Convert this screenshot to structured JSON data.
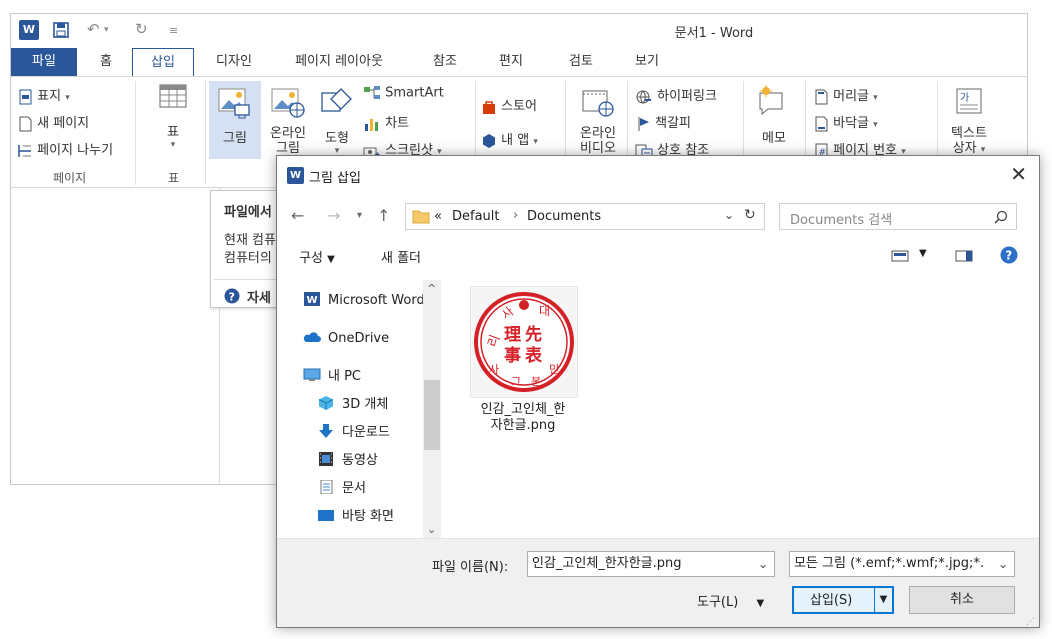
{
  "word": {
    "title": "문서1 - Word",
    "tabs": [
      {
        "label": "파일"
      },
      {
        "label": "홈"
      },
      {
        "label": "삽입"
      },
      {
        "label": "디자인"
      },
      {
        "label": "페이지 레이아웃"
      },
      {
        "label": "참조"
      },
      {
        "label": "편지"
      },
      {
        "label": "검토"
      },
      {
        "label": "보기"
      }
    ],
    "ribbon": {
      "pages_group": {
        "cover": "표지",
        "new_page": "새 페이지",
        "page_break": "페이지 나누기",
        "label": "페이지"
      },
      "table_group": {
        "table": "표",
        "label": "표"
      },
      "illustrations": {
        "picture": "그림",
        "online_picture_1": "온라인",
        "online_picture_2": "그림",
        "shapes": "도형",
        "smartart": "SmartArt",
        "chart": "차트",
        "screenshot": "스크린샷"
      },
      "addins": {
        "store": "스토어",
        "my_apps": "내 앱"
      },
      "media": {
        "online_video_1": "온라인",
        "online_video_2": "비디오"
      },
      "links": {
        "hyperlink": "하이퍼링크",
        "bookmark": "책갈피",
        "cross_ref": "상호 참조"
      },
      "comments": {
        "memo": "메모"
      },
      "header_footer": {
        "header": "머리글",
        "footer": "바닥글",
        "page_number": "페이지 번호"
      },
      "text": {
        "textbox_1": "텍스트",
        "textbox_2": "상자"
      }
    },
    "tooltip": {
      "line1": "파일에서",
      "line2": "현재 컴퓨",
      "line3": "컴퓨터의",
      "more": "자세"
    }
  },
  "dialog": {
    "title": "그림 삽입",
    "path": {
      "prefix": "«",
      "segments": [
        "Default",
        "Documents"
      ]
    },
    "search_placeholder": "Documents 검색",
    "toolbar": {
      "organize": "구성",
      "new_folder": "새 폴더"
    },
    "nav": [
      {
        "label": "Microsoft Word"
      },
      {
        "label": "OneDrive"
      },
      {
        "label": "내 PC"
      },
      {
        "label": "3D 개체"
      },
      {
        "label": "다운로드"
      },
      {
        "label": "동영상"
      },
      {
        "label": "문서"
      },
      {
        "label": "바탕 화면"
      }
    ],
    "file": {
      "name_line1": "인감_고인체_한",
      "name_line2": "자한글.png"
    },
    "seal": {
      "top": "대",
      "left": "리",
      "right": "사",
      "c1": "理",
      "c2": "先",
      "c3": "事",
      "c4": "表",
      "b1": "사",
      "b2": "그",
      "b3": "본",
      "b4": "민"
    },
    "filename_label": "파일 이름(N):",
    "filename_value": "인감_고인체_한자한글.png",
    "filter_value": "모든 그림 (*.emf;*.wmf;*.jpg;*.",
    "tools_label": "도구(L)",
    "insert_label": "삽입(S)",
    "cancel_label": "취소"
  }
}
